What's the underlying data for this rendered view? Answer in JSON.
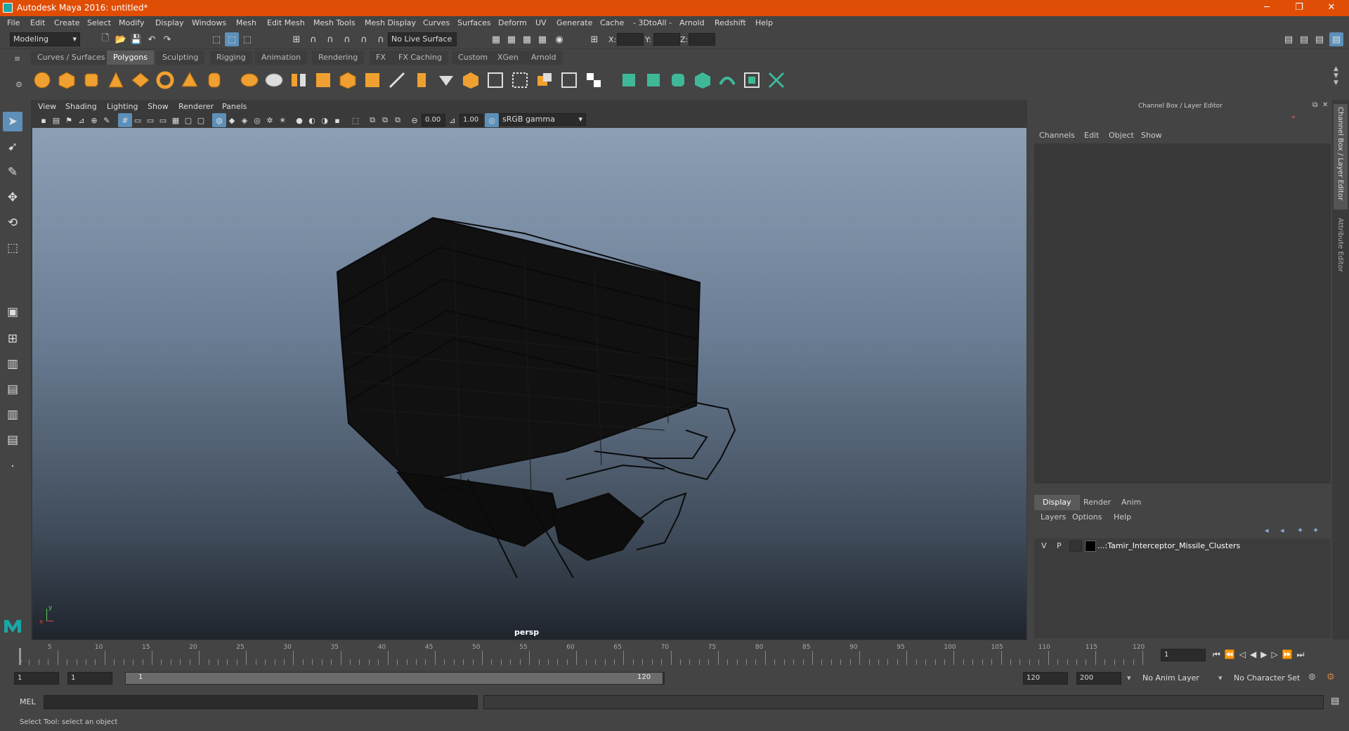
{
  "window": {
    "title": "Autodesk Maya 2016: untitled*",
    "minimize": "─",
    "restore": "❐",
    "close": "✕"
  },
  "menubar": [
    "File",
    "Edit",
    "Create",
    "Select",
    "Modify",
    "Display",
    "Windows",
    "Mesh",
    "Edit Mesh",
    "Mesh Tools",
    "Mesh Display",
    "Curves",
    "Surfaces",
    "Deform",
    "UV",
    "Generate",
    "Cache",
    "- 3DtoAll -",
    "Arnold",
    "Redshift",
    "Help"
  ],
  "statusline": {
    "mode_select": "Modeling",
    "live_surface": "No Live Surface",
    "x_label": "X:",
    "y_label": "Y:",
    "z_label": "Z:"
  },
  "shelf": {
    "tabs": [
      "Curves / Surfaces",
      "Polygons",
      "Sculpting",
      "Rigging",
      "Animation",
      "Rendering",
      "FX",
      "FX Caching",
      "Custom",
      "XGen",
      "Arnold"
    ],
    "active_tab": "Polygons"
  },
  "viewport": {
    "menus": [
      "View",
      "Shading",
      "Lighting",
      "Show",
      "Renderer",
      "Panels"
    ],
    "exposure": "0.00",
    "gamma": "1.00",
    "color_space": "sRGB gamma",
    "camera_label": "persp",
    "axis_y": "y",
    "axis_x": "x"
  },
  "right_panel": {
    "header": "Channel Box / Layer Editor",
    "channel_menus": [
      "Channels",
      "Edit",
      "Object",
      "Show"
    ],
    "layer_tabs": [
      "Display",
      "Render",
      "Anim"
    ],
    "active_layer_tab": "Display",
    "layer_menus": [
      "Layers",
      "Options",
      "Help"
    ],
    "layer": {
      "v": "V",
      "p": "P",
      "name": "...:Tamir_Interceptor_Missile_Clusters"
    }
  },
  "side_tabs": [
    "Channel Box / Layer Editor",
    "Attribute Editor"
  ],
  "timeline": {
    "ticks": [
      1,
      5,
      10,
      15,
      20,
      25,
      30,
      35,
      40,
      45,
      50,
      55,
      60,
      65,
      70,
      75,
      80,
      85,
      90,
      95,
      100,
      105,
      110,
      115,
      120
    ],
    "current_frame": "1"
  },
  "range": {
    "start": "1",
    "playback_start": "1",
    "slider_start": "1",
    "slider_end": "120",
    "playback_end": "120",
    "end": "200",
    "anim_layer": "No Anim Layer",
    "character_set": "No Character Set"
  },
  "command_line": {
    "label": "MEL"
  },
  "help_line": "Select Tool: select an object",
  "colors": {
    "title_bar": "#e04d05",
    "accent": "#5d8fb8",
    "shelf_icon": "#f0a030",
    "shelf_icon_green": "#3fb89a"
  }
}
